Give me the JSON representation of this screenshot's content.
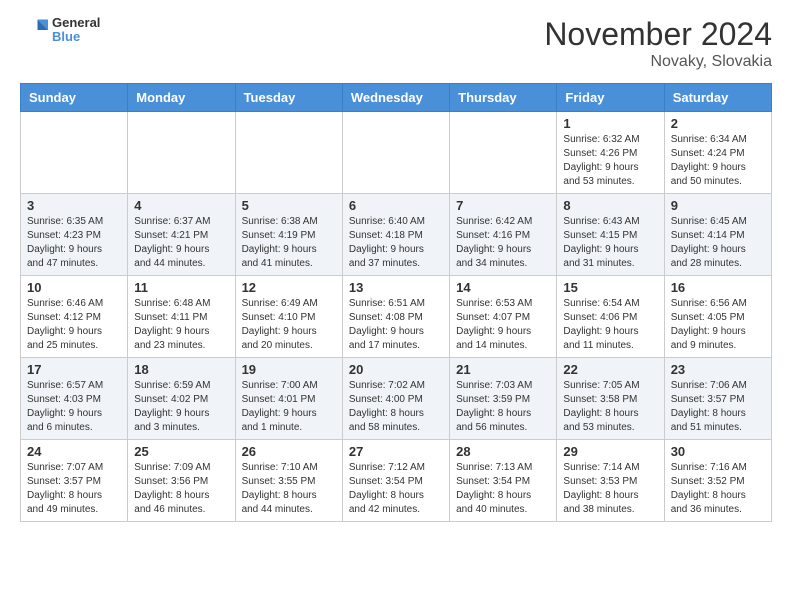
{
  "header": {
    "logo_line1": "General",
    "logo_line2": "Blue",
    "month_title": "November 2024",
    "location": "Novaky, Slovakia"
  },
  "days_of_week": [
    "Sunday",
    "Monday",
    "Tuesday",
    "Wednesday",
    "Thursday",
    "Friday",
    "Saturday"
  ],
  "weeks": [
    [
      {
        "day": "",
        "info": ""
      },
      {
        "day": "",
        "info": ""
      },
      {
        "day": "",
        "info": ""
      },
      {
        "day": "",
        "info": ""
      },
      {
        "day": "",
        "info": ""
      },
      {
        "day": "1",
        "info": "Sunrise: 6:32 AM\nSunset: 4:26 PM\nDaylight: 9 hours and 53 minutes."
      },
      {
        "day": "2",
        "info": "Sunrise: 6:34 AM\nSunset: 4:24 PM\nDaylight: 9 hours and 50 minutes."
      }
    ],
    [
      {
        "day": "3",
        "info": "Sunrise: 6:35 AM\nSunset: 4:23 PM\nDaylight: 9 hours and 47 minutes."
      },
      {
        "day": "4",
        "info": "Sunrise: 6:37 AM\nSunset: 4:21 PM\nDaylight: 9 hours and 44 minutes."
      },
      {
        "day": "5",
        "info": "Sunrise: 6:38 AM\nSunset: 4:19 PM\nDaylight: 9 hours and 41 minutes."
      },
      {
        "day": "6",
        "info": "Sunrise: 6:40 AM\nSunset: 4:18 PM\nDaylight: 9 hours and 37 minutes."
      },
      {
        "day": "7",
        "info": "Sunrise: 6:42 AM\nSunset: 4:16 PM\nDaylight: 9 hours and 34 minutes."
      },
      {
        "day": "8",
        "info": "Sunrise: 6:43 AM\nSunset: 4:15 PM\nDaylight: 9 hours and 31 minutes."
      },
      {
        "day": "9",
        "info": "Sunrise: 6:45 AM\nSunset: 4:14 PM\nDaylight: 9 hours and 28 minutes."
      }
    ],
    [
      {
        "day": "10",
        "info": "Sunrise: 6:46 AM\nSunset: 4:12 PM\nDaylight: 9 hours and 25 minutes."
      },
      {
        "day": "11",
        "info": "Sunrise: 6:48 AM\nSunset: 4:11 PM\nDaylight: 9 hours and 23 minutes."
      },
      {
        "day": "12",
        "info": "Sunrise: 6:49 AM\nSunset: 4:10 PM\nDaylight: 9 hours and 20 minutes."
      },
      {
        "day": "13",
        "info": "Sunrise: 6:51 AM\nSunset: 4:08 PM\nDaylight: 9 hours and 17 minutes."
      },
      {
        "day": "14",
        "info": "Sunrise: 6:53 AM\nSunset: 4:07 PM\nDaylight: 9 hours and 14 minutes."
      },
      {
        "day": "15",
        "info": "Sunrise: 6:54 AM\nSunset: 4:06 PM\nDaylight: 9 hours and 11 minutes."
      },
      {
        "day": "16",
        "info": "Sunrise: 6:56 AM\nSunset: 4:05 PM\nDaylight: 9 hours and 9 minutes."
      }
    ],
    [
      {
        "day": "17",
        "info": "Sunrise: 6:57 AM\nSunset: 4:03 PM\nDaylight: 9 hours and 6 minutes."
      },
      {
        "day": "18",
        "info": "Sunrise: 6:59 AM\nSunset: 4:02 PM\nDaylight: 9 hours and 3 minutes."
      },
      {
        "day": "19",
        "info": "Sunrise: 7:00 AM\nSunset: 4:01 PM\nDaylight: 9 hours and 1 minute."
      },
      {
        "day": "20",
        "info": "Sunrise: 7:02 AM\nSunset: 4:00 PM\nDaylight: 8 hours and 58 minutes."
      },
      {
        "day": "21",
        "info": "Sunrise: 7:03 AM\nSunset: 3:59 PM\nDaylight: 8 hours and 56 minutes."
      },
      {
        "day": "22",
        "info": "Sunrise: 7:05 AM\nSunset: 3:58 PM\nDaylight: 8 hours and 53 minutes."
      },
      {
        "day": "23",
        "info": "Sunrise: 7:06 AM\nSunset: 3:57 PM\nDaylight: 8 hours and 51 minutes."
      }
    ],
    [
      {
        "day": "24",
        "info": "Sunrise: 7:07 AM\nSunset: 3:57 PM\nDaylight: 8 hours and 49 minutes."
      },
      {
        "day": "25",
        "info": "Sunrise: 7:09 AM\nSunset: 3:56 PM\nDaylight: 8 hours and 46 minutes."
      },
      {
        "day": "26",
        "info": "Sunrise: 7:10 AM\nSunset: 3:55 PM\nDaylight: 8 hours and 44 minutes."
      },
      {
        "day": "27",
        "info": "Sunrise: 7:12 AM\nSunset: 3:54 PM\nDaylight: 8 hours and 42 minutes."
      },
      {
        "day": "28",
        "info": "Sunrise: 7:13 AM\nSunset: 3:54 PM\nDaylight: 8 hours and 40 minutes."
      },
      {
        "day": "29",
        "info": "Sunrise: 7:14 AM\nSunset: 3:53 PM\nDaylight: 8 hours and 38 minutes."
      },
      {
        "day": "30",
        "info": "Sunrise: 7:16 AM\nSunset: 3:52 PM\nDaylight: 8 hours and 36 minutes."
      }
    ]
  ]
}
